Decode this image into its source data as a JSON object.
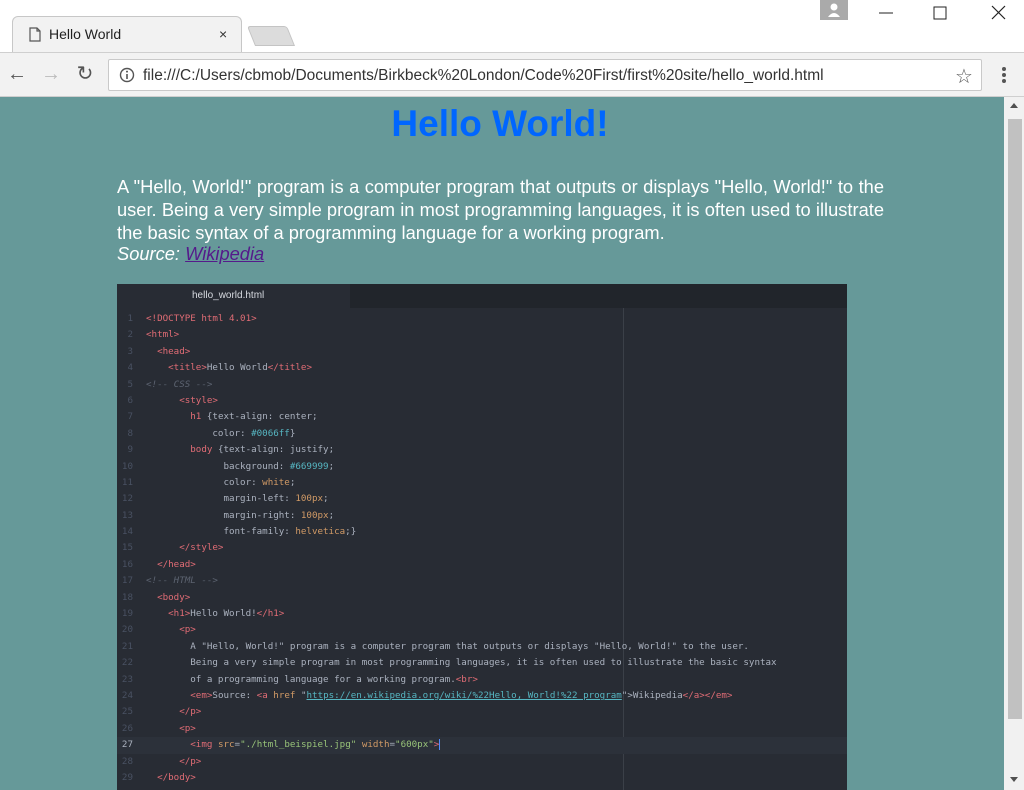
{
  "browser": {
    "tab_title": "Hello World",
    "tab_close": "×",
    "url": "file:///C:/Users/cbmob/Documents/Birkbeck%20London/Code%20First/first%20site/hello_world.html",
    "nav": {
      "back": "←",
      "forward": "→",
      "reload": "↻"
    },
    "star": "☆"
  },
  "page": {
    "heading": "Hello World!",
    "paragraph": "A \"Hello, World!\" program is a computer program that outputs or displays \"Hello, World!\" to the user. Being a very simple program in most programming languages, it is often used to illustrate the basic syntax of a programming language for a working program.",
    "source_label": "Source:",
    "source_link": "Wikipedia",
    "colors": {
      "background": "#669999",
      "heading": "#0066ff",
      "text": "#ffffff"
    }
  },
  "editor": {
    "tab_title": "hello_world.html",
    "active_line": 27,
    "lines": [
      [
        [
          "tag",
          "<!DOCTYPE html 4.01>"
        ]
      ],
      [
        [
          "tag",
          "<html>"
        ]
      ],
      [
        [
          "text",
          "  "
        ],
        [
          "tag",
          "<head>"
        ]
      ],
      [
        [
          "text",
          "    "
        ],
        [
          "tag",
          "<title>"
        ],
        [
          "text",
          "Hello World"
        ],
        [
          "tag",
          "</title>"
        ]
      ],
      [
        [
          "com",
          "<!-- CSS -->"
        ]
      ],
      [
        [
          "text",
          "      "
        ],
        [
          "tag",
          "<style>"
        ]
      ],
      [
        [
          "text",
          "        "
        ],
        [
          "tag",
          "h1"
        ],
        [
          "text",
          " {text-align: center;"
        ]
      ],
      [
        [
          "text",
          "            color: "
        ],
        [
          "val",
          "#0066ff"
        ],
        [
          "text",
          "}"
        ]
      ],
      [
        [
          "text",
          "        "
        ],
        [
          "tag",
          "body"
        ],
        [
          "text",
          " {text-align: justify;"
        ]
      ],
      [
        [
          "text",
          "              background: "
        ],
        [
          "val",
          "#669999"
        ],
        [
          "text",
          ";"
        ]
      ],
      [
        [
          "text",
          "              color: "
        ],
        [
          "num",
          "white"
        ],
        [
          "text",
          ";"
        ]
      ],
      [
        [
          "text",
          "              margin-left: "
        ],
        [
          "num",
          "100px"
        ],
        [
          "text",
          ";"
        ]
      ],
      [
        [
          "text",
          "              margin-right: "
        ],
        [
          "num",
          "100px"
        ],
        [
          "text",
          ";"
        ]
      ],
      [
        [
          "text",
          "              font-family: "
        ],
        [
          "num",
          "helvetica"
        ],
        [
          "text",
          ";}"
        ]
      ],
      [
        [
          "text",
          "      "
        ],
        [
          "tag",
          "</style>"
        ]
      ],
      [
        [
          "text",
          "  "
        ],
        [
          "tag",
          "</head>"
        ]
      ],
      [
        [
          "com",
          "<!-- HTML -->"
        ]
      ],
      [
        [
          "text",
          "  "
        ],
        [
          "tag",
          "<body>"
        ]
      ],
      [
        [
          "text",
          "    "
        ],
        [
          "tag",
          "<h1>"
        ],
        [
          "text",
          "Hello World!"
        ],
        [
          "tag",
          "</h1>"
        ]
      ],
      [
        [
          "text",
          "      "
        ],
        [
          "tag",
          "<p>"
        ]
      ],
      [
        [
          "text",
          "        A \"Hello, World!\" program is a computer program that outputs or displays \"Hello, World!\" to the user."
        ]
      ],
      [
        [
          "text",
          "        Being a very simple program in most programming languages, it is often used to illustrate the basic syntax"
        ]
      ],
      [
        [
          "text",
          "        of a programming language for a working program."
        ],
        [
          "tag",
          "<br>"
        ]
      ],
      [
        [
          "text",
          "        "
        ],
        [
          "tag",
          "<em>"
        ],
        [
          "text",
          "Source: "
        ],
        [
          "tag",
          "<a "
        ],
        [
          "attr",
          "href"
        ],
        [
          "text",
          " \""
        ],
        [
          "link",
          "https://en.wikipedia.org/wiki/%22Hello,_World!%22_program"
        ],
        [
          "text",
          "\">Wikipedia"
        ],
        [
          "tag",
          "</a></em>"
        ]
      ],
      [
        [
          "text",
          "      "
        ],
        [
          "tag",
          "</p>"
        ]
      ],
      [
        [
          "text",
          "      "
        ],
        [
          "tag",
          "<p>"
        ]
      ],
      [
        [
          "text",
          "        "
        ],
        [
          "tag",
          "<img "
        ],
        [
          "attr",
          "src"
        ],
        [
          "text",
          "="
        ],
        [
          "str",
          "\"./html_beispiel.jpg\""
        ],
        [
          "text",
          " "
        ],
        [
          "attr",
          "width"
        ],
        [
          "text",
          "="
        ],
        [
          "str",
          "\"600px\""
        ],
        [
          "tag",
          ">"
        ]
      ],
      [
        [
          "text",
          "      "
        ],
        [
          "tag",
          "</p>"
        ]
      ],
      [
        [
          "text",
          "  "
        ],
        [
          "tag",
          "</body>"
        ]
      ]
    ]
  }
}
